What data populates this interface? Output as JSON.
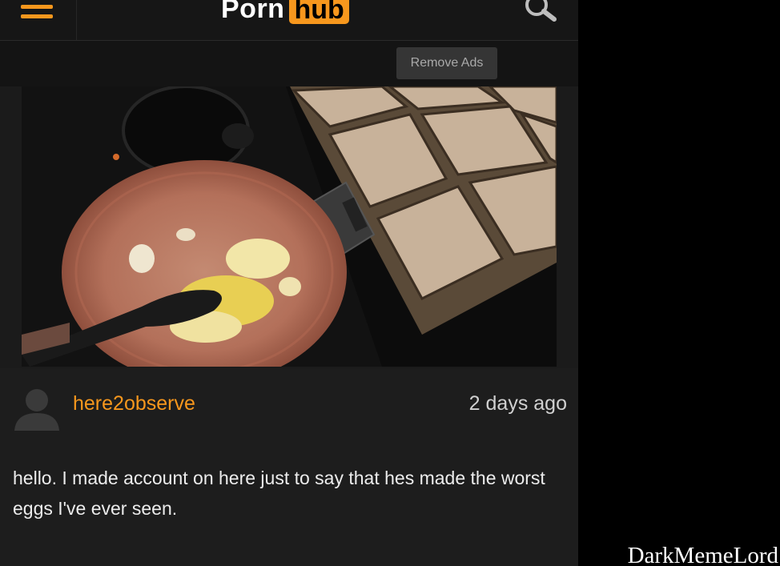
{
  "header": {
    "logo_part1": "Porn",
    "logo_part2": "hub",
    "menu_icon": "hamburger-menu-icon",
    "search_icon": "search-icon",
    "accent_color": "#f7971d"
  },
  "ads": {
    "remove_label": "Remove Ads"
  },
  "comment": {
    "username": "here2observe",
    "time": "2 days ago",
    "text": "hello. I made account on here just to say that hes made the worst eggs I've ever seen."
  },
  "watermark": "DarkMemeLord"
}
